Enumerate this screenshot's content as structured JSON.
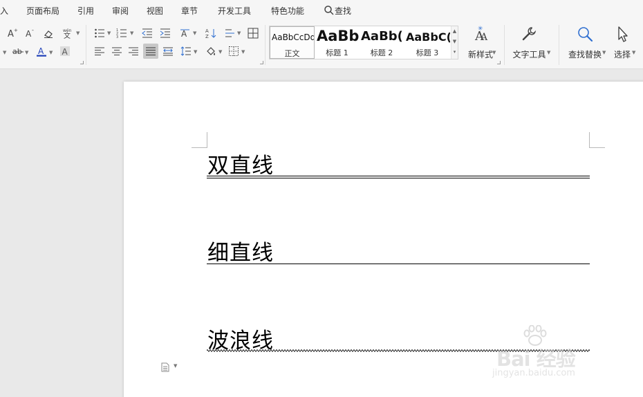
{
  "menu": {
    "items": [
      "入",
      "页面布局",
      "引用",
      "审阅",
      "视图",
      "章节",
      "开发工具",
      "特色功能"
    ],
    "search_label": "查找"
  },
  "ribbon": {
    "font_icons": [
      "grow-font-icon",
      "shrink-font-icon",
      "clear-format-icon",
      "phonetic-guide-icon",
      "strikethrough-abc-icon",
      "font-color-icon",
      "character-shading-icon"
    ],
    "paragraph_icons": [
      "bullets-icon",
      "numbering-icon",
      "decrease-indent-icon",
      "increase-indent-icon",
      "text-direction-icon",
      "sort-icon",
      "line-numbers-icon",
      "table-borders-icon",
      "align-left-icon",
      "align-center-icon",
      "align-right-icon",
      "justify-icon",
      "distributed-icon",
      "line-spacing-icon",
      "shading-icon",
      "borders-icon"
    ],
    "styles": [
      {
        "sample": "AaBbCcDd",
        "name": "正文"
      },
      {
        "sample": "AaBb",
        "name": "标题 1"
      },
      {
        "sample": "AaBb(",
        "name": "标题 2"
      },
      {
        "sample": "AaBbC(",
        "name": "标题 3"
      }
    ],
    "new_style_label": "新样式",
    "text_tools_label": "文字工具",
    "find_replace_label": "查找替换",
    "select_label": "选择"
  },
  "document": {
    "headings": [
      "双直线",
      "细直线",
      "波浪线"
    ]
  },
  "watermark": {
    "logo_text": "Bai 经验",
    "url": "jingyan.baidu.com"
  },
  "colors": {
    "font_color_bar": "#1f3fb8",
    "accent_search": "#2f6fd0"
  }
}
